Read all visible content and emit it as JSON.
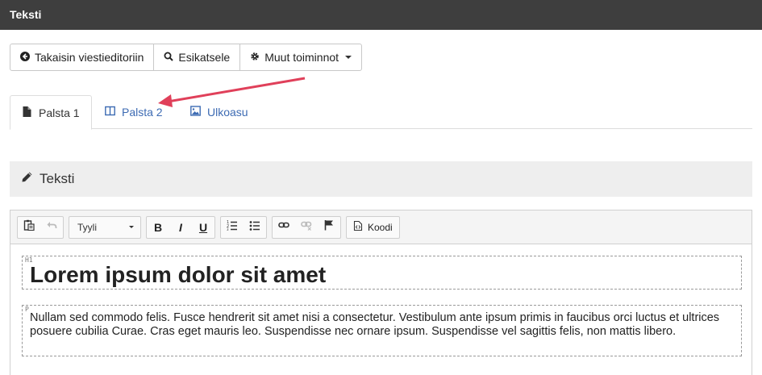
{
  "window": {
    "title": "Teksti"
  },
  "actions": {
    "back_label": "Takaisin viestieditoriin",
    "preview_label": "Esikatsele",
    "more_label": "Muut toiminnot"
  },
  "tabs": [
    {
      "label": "Palsta 1",
      "icon": "file-icon",
      "active": true
    },
    {
      "label": "Palsta 2",
      "icon": "columns-icon",
      "active": false
    },
    {
      "label": "Ulkoasu",
      "icon": "image-icon",
      "active": false
    }
  ],
  "section": {
    "title": "Teksti",
    "icon": "pencil-icon"
  },
  "editor": {
    "style_select": "Tyyli",
    "code_label": "Koodi",
    "toolbar_icons": [
      "paste-icon",
      "undo-icon",
      "bold-icon",
      "italic-icon",
      "underline-icon",
      "ordered-list-icon",
      "bulleted-list-icon",
      "link-icon",
      "unlink-icon",
      "flag-icon",
      "code-icon"
    ],
    "bold": "B",
    "italic": "I",
    "underline": "U",
    "blocks": [
      {
        "tag": "H1",
        "text": "Lorem ipsum dolor sit amet"
      },
      {
        "tag": "P",
        "text": "Nullam sed commodo felis. Fusce hendrerit sit amet nisi a consectetur. Vestibulum ante ipsum primis in faucibus orci luctus et ultrices posuere cubilia Curae. Cras eget mauris leo. Suspendisse nec ornare ipsum. Suspendisse vel sagittis felis, non mattis libero."
      }
    ]
  },
  "colors": {
    "topbar": "#3e3e3e",
    "link": "#3d6bb3",
    "arrow": "#e0405a"
  }
}
